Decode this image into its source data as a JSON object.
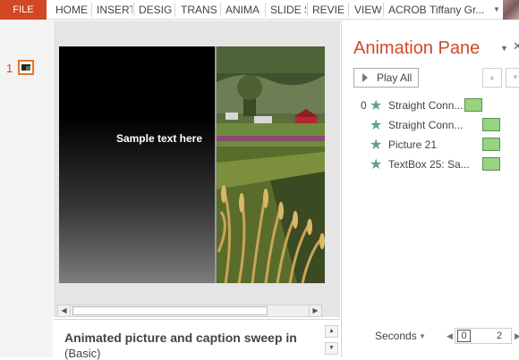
{
  "ribbon": {
    "file_tab": "FILE",
    "tabs": [
      "HOME",
      "INSERT",
      "DESIG",
      "TRANS",
      "ANIMA",
      "SLIDE S",
      "REVIE",
      "VIEW",
      "ACROB"
    ],
    "user_name": "Tiffany Gr...",
    "accent_color": "#d24726"
  },
  "thumbnails": {
    "slide_number": "1"
  },
  "slide": {
    "caption_text": "Sample text here"
  },
  "notes": {
    "title": "Animated picture and caption sweep in",
    "subtitle": "(Basic)"
  },
  "animation_pane": {
    "title": "Animation Pane",
    "play_all_label": "Play All",
    "items": [
      {
        "number": "0",
        "label": "Straight Conn...",
        "icon": "star-icon",
        "bar_color": "#97d480"
      },
      {
        "number": "",
        "label": "Straight Conn...",
        "icon": "star-icon",
        "bar_color": "#97d480"
      },
      {
        "number": "",
        "label": "Picture 21",
        "icon": "star-icon",
        "bar_color": "#97d480"
      },
      {
        "number": "",
        "label": "TextBox 25: Sa...",
        "icon": "star-icon",
        "bar_color": "#97d480"
      }
    ],
    "seconds_label": "Seconds",
    "timeline_start": "0",
    "timeline_end": "2"
  }
}
